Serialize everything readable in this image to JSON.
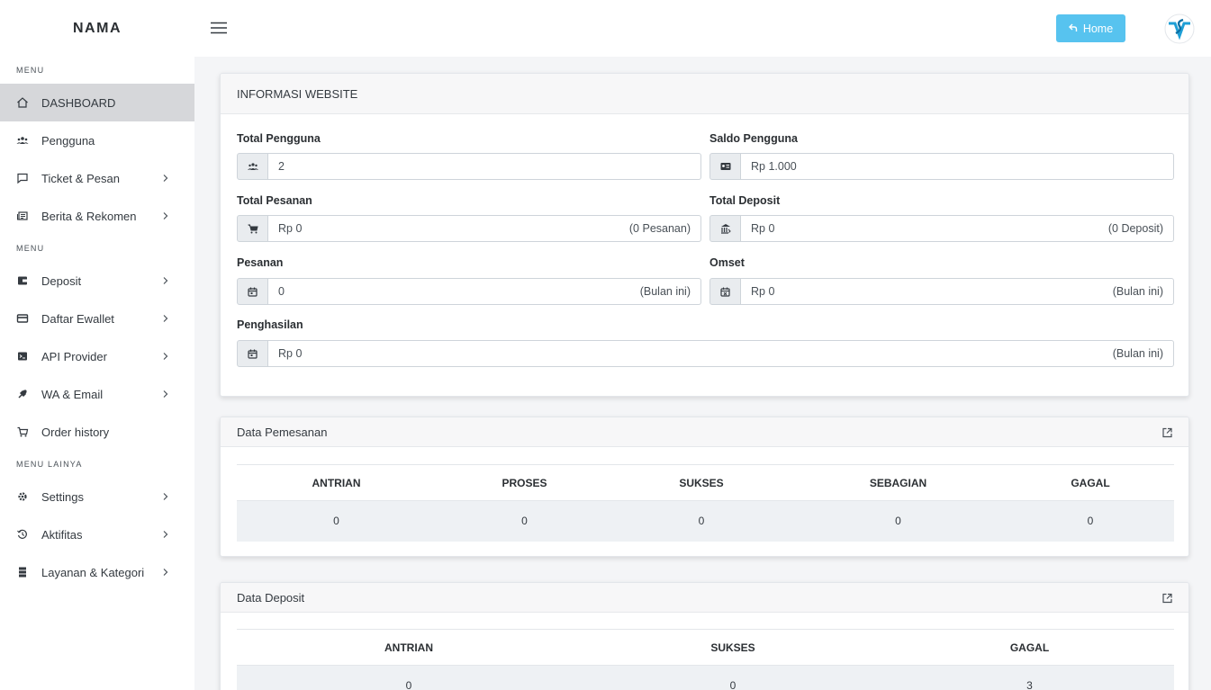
{
  "brand": "NAMA",
  "sidebar": {
    "sections": [
      {
        "title": "MENU"
      },
      {
        "title": "MENU"
      },
      {
        "title": "MENU LAINYA"
      }
    ],
    "items": [
      {
        "label": "DASHBOARD",
        "icon": "home-icon"
      },
      {
        "label": "Pengguna",
        "icon": "users-icon"
      },
      {
        "label": "Ticket & Pesan",
        "icon": "message-icon"
      },
      {
        "label": "Berita & Rekomen",
        "icon": "news-icon"
      },
      {
        "label": "Deposit",
        "icon": "wallet-icon"
      },
      {
        "label": "Daftar Ewallet",
        "icon": "card-icon"
      },
      {
        "label": "API Provider",
        "icon": "terminal-icon"
      },
      {
        "label": "WA & Email",
        "icon": "plug-icon"
      },
      {
        "label": "Order history",
        "icon": "cart-icon"
      },
      {
        "label": "Settings",
        "icon": "gear-icon"
      },
      {
        "label": "Aktifitas",
        "icon": "history-icon"
      },
      {
        "label": "Layanan & Kategori",
        "icon": "server-icon"
      }
    ]
  },
  "header": {
    "home_label": "Home"
  },
  "info": {
    "title": "INFORMASI WEBSITE",
    "total_pengguna": {
      "label": "Total Pengguna",
      "value": "2"
    },
    "saldo_pengguna": {
      "label": "Saldo Pengguna",
      "value": "Rp 1.000"
    },
    "total_pesanan": {
      "label": "Total Pesanan",
      "value": "Rp 0",
      "suffix": "(0 Pesanan)"
    },
    "total_deposit": {
      "label": "Total Deposit",
      "value": "Rp 0",
      "suffix": "(0 Deposit)"
    },
    "pesanan": {
      "label": "Pesanan",
      "value": "0",
      "suffix": "(Bulan ini)"
    },
    "omset": {
      "label": "Omset",
      "value": "Rp 0",
      "suffix": "(Bulan ini)"
    },
    "penghasilan": {
      "label": "Penghasilan",
      "value": "Rp 0",
      "suffix": "(Bulan ini)"
    }
  },
  "pemesanan": {
    "title": "Data Pemesanan",
    "headers": [
      "ANTRIAN",
      "PROSES",
      "SUKSES",
      "SEBAGIAN",
      "GAGAL"
    ],
    "values": [
      "0",
      "0",
      "0",
      "0",
      "0"
    ]
  },
  "deposit": {
    "title": "Data Deposit",
    "headers": [
      "ANTRIAN",
      "SUKSES",
      "GAGAL"
    ],
    "values": [
      "0",
      "0",
      "3"
    ]
  },
  "colors": {
    "accent": "#57c3ef",
    "active_bg": "#d6d7da"
  }
}
